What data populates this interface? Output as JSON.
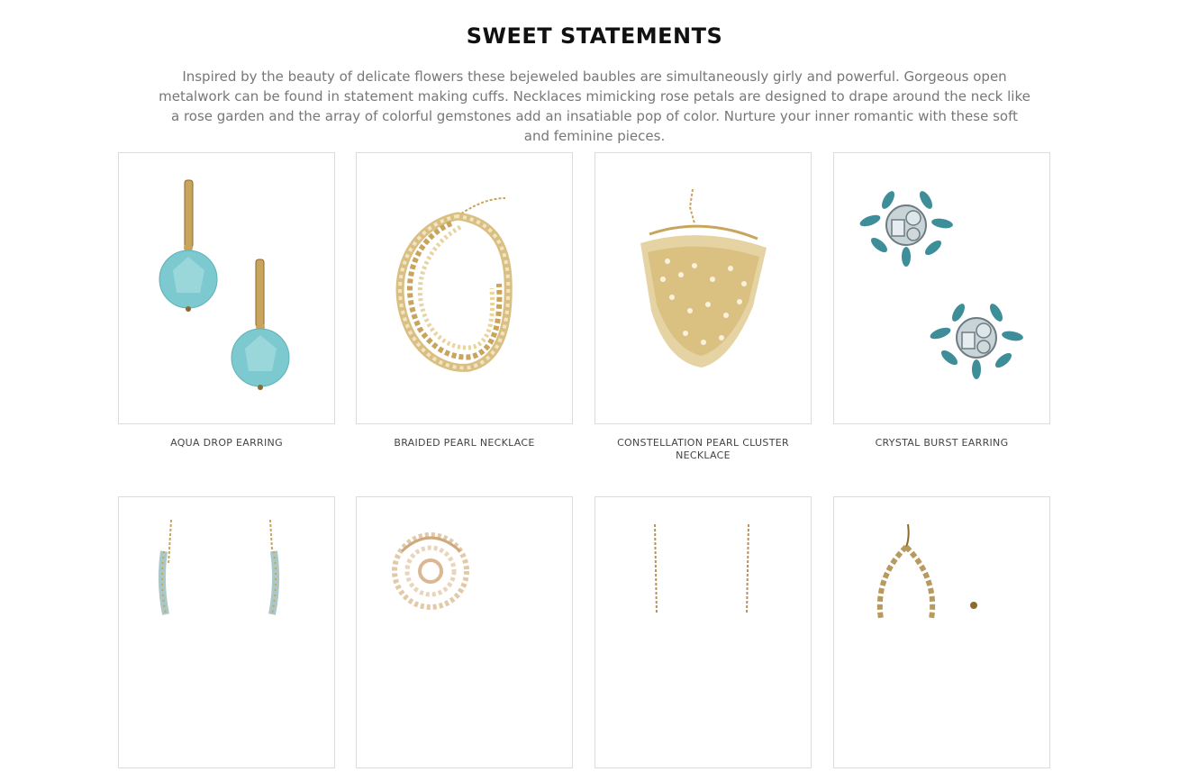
{
  "header": {
    "title": "SWEET STATEMENTS",
    "description": "Inspired by the beauty of delicate flowers these bejeweled baubles are simultaneously girly and powerful. Gorgeous open metalwork can be found in statement making cuffs. Necklaces mimicking rose petals are designed to drape around the neck like a rose garden and the array of colorful gemstones add an insatiable pop of color. Nurture your inner romantic with these soft and feminine pieces."
  },
  "products": [
    {
      "name": "AQUA DROP EARRING",
      "image": "aqua-drop-earring-image"
    },
    {
      "name": "BRAIDED PEARL NECKLACE",
      "image": "braided-pearl-necklace-image"
    },
    {
      "name": "CONSTELLATION PEARL CLUSTER NECKLACE",
      "image": "constellation-necklace-image"
    },
    {
      "name": "CRYSTAL BURST EARRING",
      "image": "crystal-burst-earring-image"
    },
    {
      "name": "",
      "image": "leaf-chain-earring-image"
    },
    {
      "name": "",
      "image": "crystal-rose-ring-image"
    },
    {
      "name": "",
      "image": "chain-drop-earring-image"
    },
    {
      "name": "",
      "image": "gold-leaf-hoop-earring-image"
    }
  ],
  "colors": {
    "title": "#111111",
    "text": "#777777",
    "label": "#444444",
    "border": "#dcdcdc",
    "gold": "#c9a45c",
    "aqua": "#7cc9cf",
    "teal": "#3e8e9a"
  }
}
